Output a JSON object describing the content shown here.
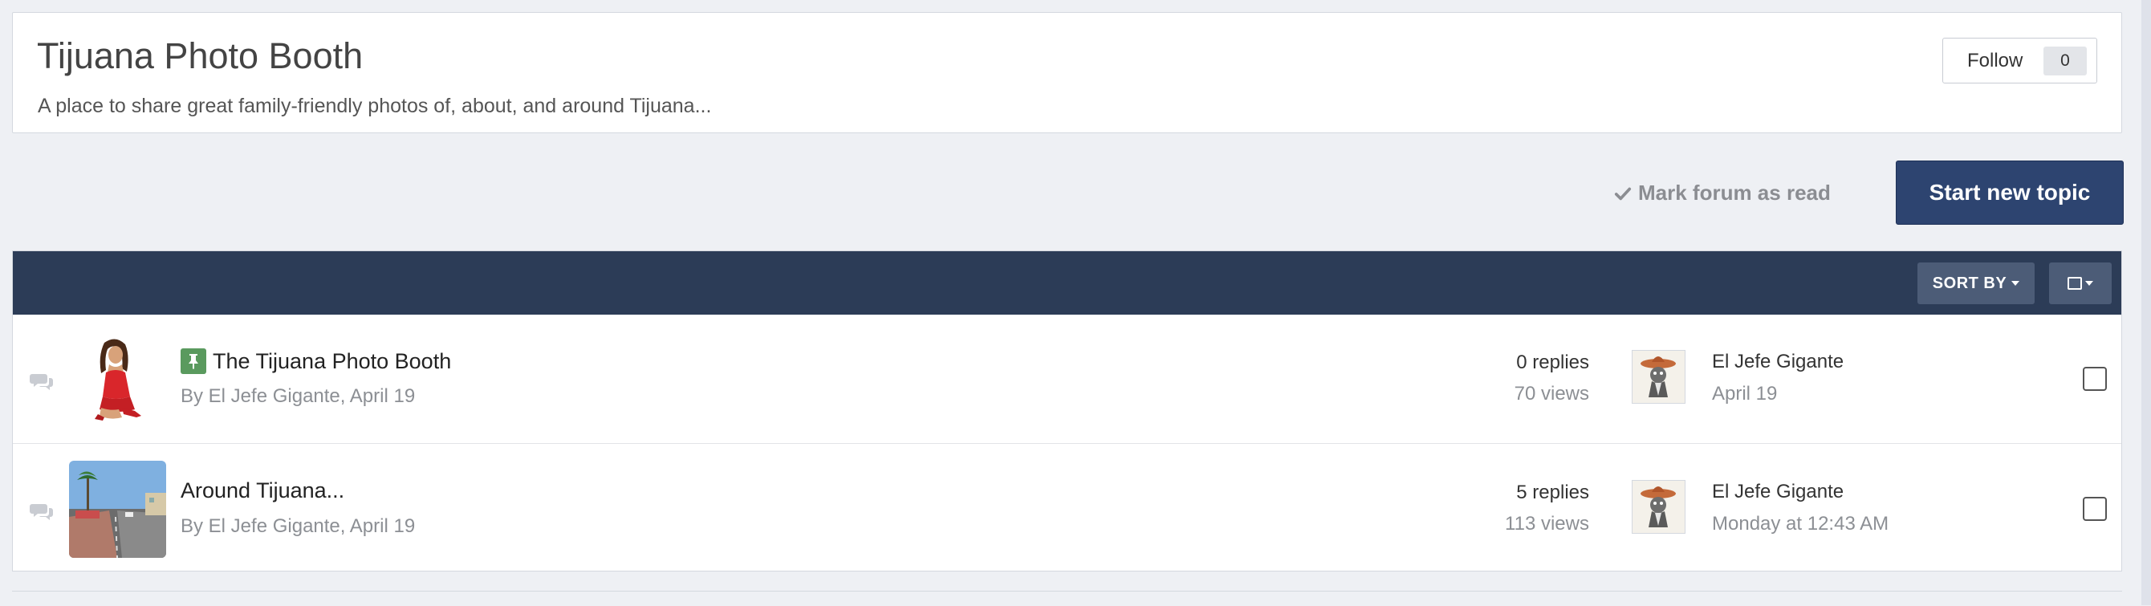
{
  "forum": {
    "title": "Tijuana Photo Booth",
    "description": "A place to share great family-friendly photos of, about, and around Tijuana...",
    "follow_label": "Follow",
    "follow_count": "0"
  },
  "actions": {
    "mark_read": "Mark forum as read",
    "start_topic": "Start new topic"
  },
  "table_header": {
    "sort_label": "SORT BY"
  },
  "topics": [
    {
      "pinned": true,
      "title": "The Tijuana Photo Booth",
      "meta": "By El Jefe Gigante, April 19",
      "replies": "0 replies",
      "views": "70 views",
      "last_user": "El Jefe Gigante",
      "last_date": "April 19"
    },
    {
      "pinned": false,
      "title": "Around Tijuana...",
      "meta": "By El Jefe Gigante, April 19",
      "replies": "5 replies",
      "views": "113 views",
      "last_user": "El Jefe Gigante",
      "last_date": "Monday at 12:43 AM"
    }
  ],
  "colors": {
    "header_bar": "#2c3c57",
    "primary_button": "#2d4470",
    "pin_badge": "#5a9a5e"
  }
}
